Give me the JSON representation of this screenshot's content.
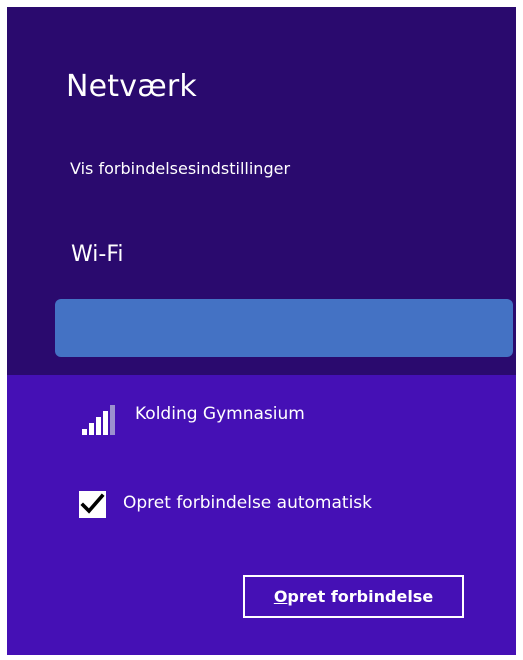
{
  "panel": {
    "title": "Netværk",
    "settings_link": "Vis forbindelsesindstillinger"
  },
  "wifi_section": {
    "heading": "Wi-Fi",
    "selected_network": {
      "name": "Kolding Gymnasium",
      "signal_strength": "4/5",
      "signal_icon": "wifi-signal-icon",
      "auto_connect_checked": true,
      "auto_connect_label": "Opret forbindelse automatisk",
      "connect_button": {
        "accelerator": "O",
        "rest_label": "pret forbindelse"
      }
    }
  },
  "colors": {
    "panel_background": "#2a0a6e",
    "expanded_background": "#4510b5",
    "selection_highlight": "#4472c4",
    "text": "#ffffff"
  }
}
